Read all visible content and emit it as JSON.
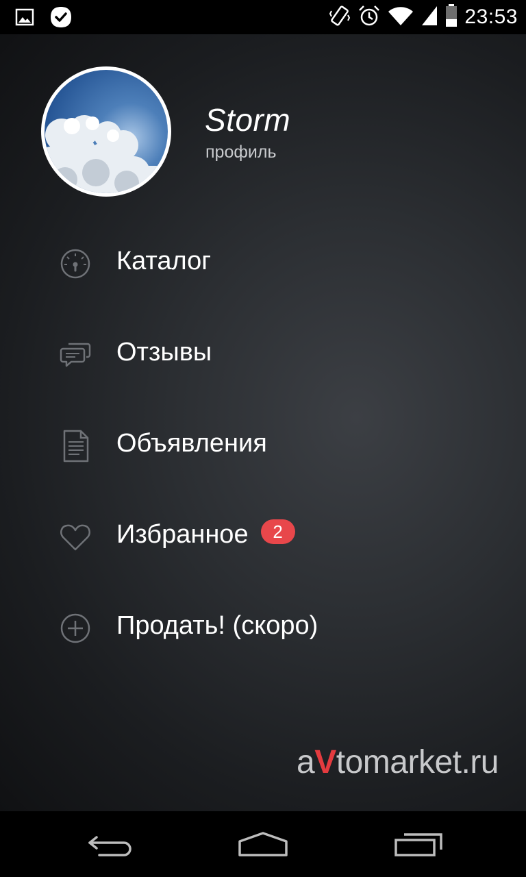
{
  "status_bar": {
    "time": "23:53",
    "icons": [
      "image-notification-icon",
      "check-badge-icon",
      "vibrate-icon",
      "alarm-icon",
      "wifi-icon",
      "signal-icon",
      "battery-icon"
    ]
  },
  "profile": {
    "name": "Storm",
    "subtitle": "профиль"
  },
  "menu": {
    "items": [
      {
        "label": "Каталог",
        "icon": "speedometer-icon"
      },
      {
        "label": "Отзывы",
        "icon": "chat-bubbles-icon"
      },
      {
        "label": "Объявления",
        "icon": "document-icon"
      },
      {
        "label": "Избранное",
        "icon": "heart-icon",
        "badge": "2"
      },
      {
        "label": "Продать! (скоро)",
        "icon": "plus-circle-icon"
      }
    ]
  },
  "logo": {
    "part1": "a",
    "accent": "V",
    "part2": "tomarket",
    "part3": ".ru"
  },
  "nav_bar": {
    "buttons": [
      "back-icon",
      "home-icon",
      "recent-apps-icon"
    ]
  },
  "colors": {
    "badge": "#e8474b",
    "logo_accent": "#e43b3f",
    "text": "#ffffff",
    "icon": "#6f7277"
  }
}
